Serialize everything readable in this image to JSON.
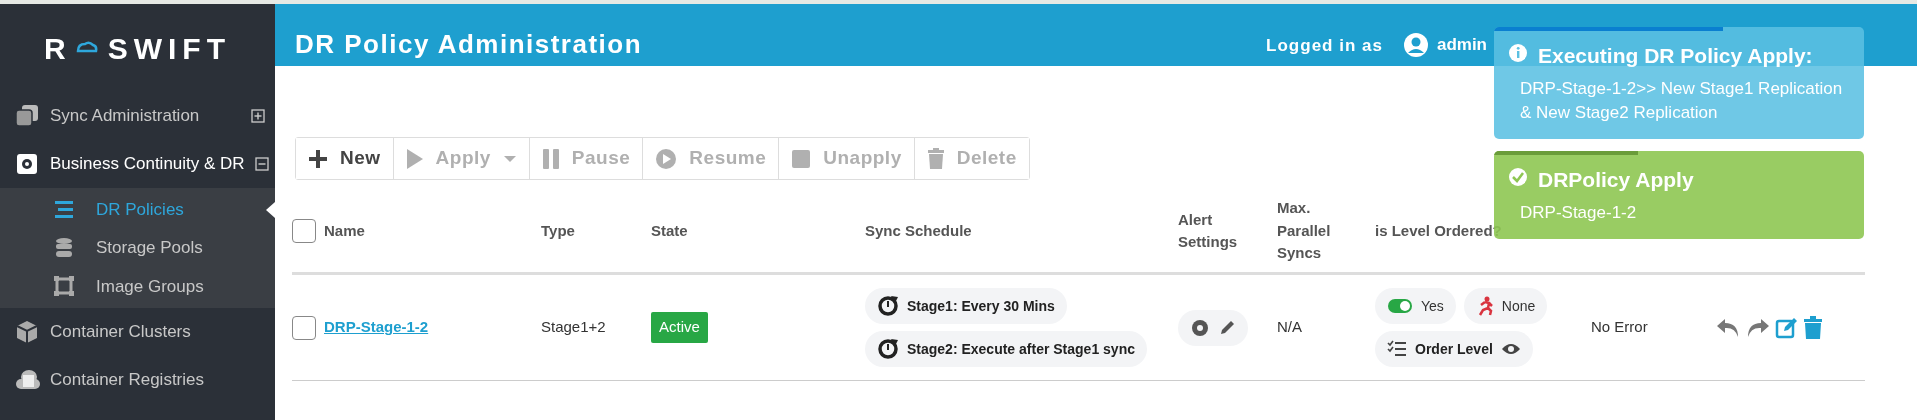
{
  "sidebar": {
    "logo_letter": "R",
    "logo_text": "SWIFT",
    "items": [
      {
        "label": "Sync Administration",
        "selected": false,
        "expanded": false
      },
      {
        "label": "Business Continuity & DR",
        "selected": true,
        "expanded": true,
        "children": [
          {
            "label": "DR Policies",
            "selected": true
          },
          {
            "label": "Storage Pools",
            "selected": false
          },
          {
            "label": "Image Groups",
            "selected": false
          }
        ]
      },
      {
        "label": "Container Clusters",
        "selected": false
      },
      {
        "label": "Container Registries",
        "selected": false
      }
    ]
  },
  "header": {
    "title": "DR Policy Administration",
    "logged_in_label": "Logged in as",
    "user": "admin"
  },
  "toolbar": [
    {
      "label": "New",
      "disabled": false
    },
    {
      "label": "Apply",
      "disabled": true,
      "has_menu": true
    },
    {
      "label": "Pause",
      "disabled": true
    },
    {
      "label": "Resume",
      "disabled": true
    },
    {
      "label": "Unapply",
      "disabled": true
    },
    {
      "label": "Delete",
      "disabled": true
    }
  ],
  "table": {
    "select_all_checked": false,
    "columns": [
      "Name",
      "Type",
      "State",
      "Sync Schedule",
      "Alert Settings",
      "Max. Parallel Syncs",
      "is Level Ordered?"
    ],
    "rows": [
      {
        "checked": false,
        "name": "DRP-Stage-1-2",
        "type": "Stage1+2",
        "state": "Active",
        "schedules": [
          "Stage1: Every 30 Mins",
          "Stage2: Execute after Stage1 sync"
        ],
        "max_parallel": "N/A",
        "level_ordered": {
          "on": true,
          "label": "Yes"
        },
        "priority": "None",
        "order": "Order Level",
        "last_error": "No Error"
      }
    ]
  },
  "toasts": [
    {
      "kind": "info",
      "title": "Executing DR Policy Apply:",
      "message": "DRP-Stage-1-2>> New Stage1 Replication & New Stage2 Replication",
      "level": 0.62
    },
    {
      "kind": "success",
      "title": "DRPolicy Apply",
      "message": "DRP-Stage-1-2",
      "level": 0.39
    }
  ]
}
